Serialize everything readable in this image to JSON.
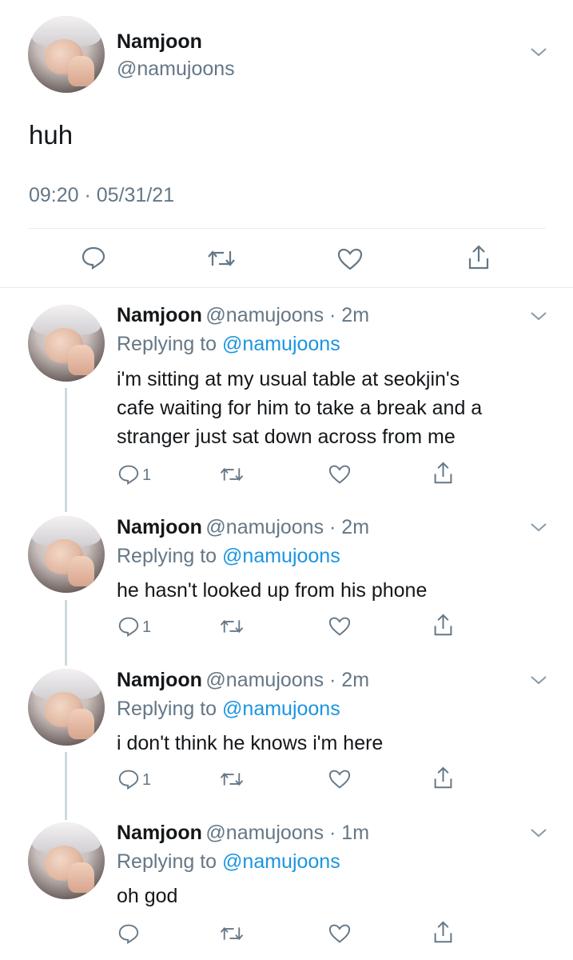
{
  "main_tweet": {
    "name": "Namjoon",
    "handle": "@namujoons",
    "text": "huh",
    "timestamp": "09:20 · 05/31/21"
  },
  "replies": [
    {
      "name": "Namjoon",
      "handle_time": "@namujoons · 2m",
      "replying_prefix": "Replying to",
      "replying_handle": "@namujoons",
      "lines": [
        "i'm sitting at my usual table at seokjin's",
        "cafe waiting for him to take a break and a",
        "stranger just sat down across from me"
      ],
      "reply_count": "1"
    },
    {
      "name": "Namjoon",
      "handle_time": "@namujoons · 2m",
      "replying_prefix": "Replying to",
      "replying_handle": "@namujoons",
      "lines": [
        "he hasn't looked up from his phone"
      ],
      "reply_count": "1"
    },
    {
      "name": "Namjoon",
      "handle_time": "@namujoons · 2m",
      "replying_prefix": "Replying to",
      "replying_handle": "@namujoons",
      "lines": [
        "i don't think he knows i'm here"
      ],
      "reply_count": "1"
    },
    {
      "name": "Namjoon",
      "handle_time": "@namujoons · 1m",
      "replying_prefix": "Replying to",
      "replying_handle": "@namujoons",
      "lines": [
        "oh god"
      ],
      "reply_count": ""
    }
  ],
  "colors": {
    "text": "#14171a",
    "muted": "#657786",
    "link": "#1b95e0",
    "divider": "#e6ecf0"
  },
  "icons": [
    "reply-icon",
    "retweet-icon",
    "like-icon",
    "share-icon",
    "chevron-down-icon"
  ]
}
